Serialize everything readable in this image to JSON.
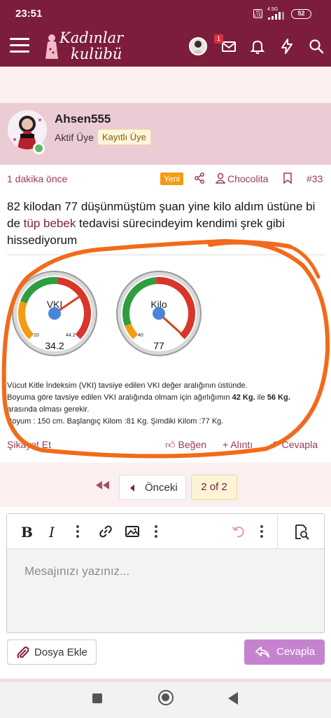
{
  "status_bar": {
    "time": "23:51",
    "volte": "Vo LTE",
    "network": "4.5G",
    "battery": "52"
  },
  "header": {
    "notification_count": "1"
  },
  "post": {
    "username": "Ahsen555",
    "user_title": "Aktif Üye",
    "user_banner": "Kayıtlı Üye",
    "time_ago": "1 dakika önce",
    "new_badge": "Yeni",
    "author_label": "Chocolita",
    "post_number": "#33",
    "text_part1": "82 kilodan 77 düşünmüştüm şuan yine kilo aldım üstüne bi de ",
    "text_link": "tüp bebek",
    "text_part2": " tedavisi sürecindeyim kendimi şrek gibi hissediyorum",
    "gauges": {
      "vki": {
        "label": "VKI",
        "min": "10",
        "max": "44.2",
        "value_text": "34.2",
        "value": 34.2
      },
      "kilo": {
        "label": "Kilo",
        "min": "40",
        "max": "",
        "value_text": "77",
        "value": 77
      }
    },
    "signature": {
      "line1": "Vücut Kitle İndeksim (VKI) tavsiye edilen VKI değer aralığının üstünde.",
      "line2_pre": "Boyuma göre tavsiye edilen VKI aralığında olmam için ağırlığımın ",
      "line2_b1": "42 Kg.",
      "line2_mid": " ile ",
      "line2_b2": "56 Kg.",
      "line3": "arasında olması gerekir.",
      "line4": "Boyum : 150 cm. Başlangıç Kilom :81 Kg. Şimdiki Kilom :77 Kg."
    },
    "actions": {
      "report": "Şikayet Et",
      "like": "Beğen",
      "quote": "+ Alıntı",
      "reply": "Cevapla"
    }
  },
  "pagination": {
    "prev_label": "Önceki",
    "current": "2 of 2"
  },
  "editor": {
    "placeholder": "Mesajınızı yazınız...",
    "attach_label": "Dosya Ekle",
    "reply_label": "Cevapla"
  },
  "colors": {
    "brand": "#7c1d3c",
    "accent_orange": "#f39c12",
    "reply_button": "#c583cf",
    "scribble": "#f26a1b"
  }
}
